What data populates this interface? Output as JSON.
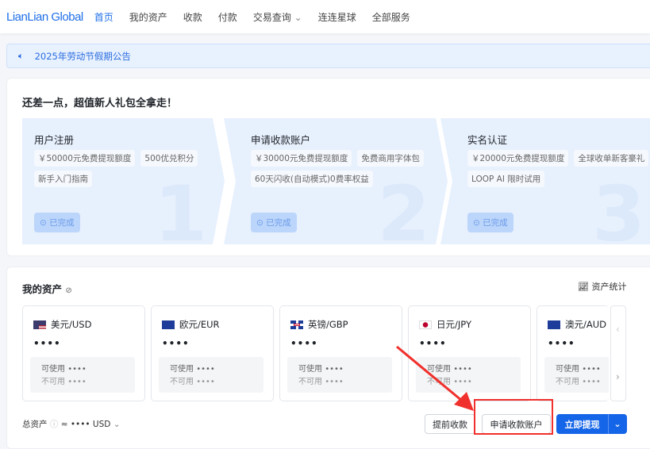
{
  "header": {
    "logo": "LianLian Global",
    "nav": [
      "首页",
      "我的资产",
      "收款",
      "付款",
      "交易查询",
      "连连星球",
      "全部服务"
    ]
  },
  "notice": {
    "text": "2025年劳动节假期公告"
  },
  "promo": {
    "title": "还差一点，超值新人礼包全拿走！",
    "steps": [
      {
        "title": "用户注册",
        "tags": [
          "￥50000元免费提现额度",
          "500优兑积分",
          "新手入门指南"
        ],
        "status": "已完成",
        "num": "1"
      },
      {
        "title": "申请收款账户",
        "tags": [
          "￥30000元免费提现额度",
          "免费商用字体包",
          "60天闪收(自动模式)0费率权益"
        ],
        "status": "已完成",
        "num": "2"
      },
      {
        "title": "实名认证",
        "tags": [
          "￥20000元免费提现额度",
          "全球收单新客豪礼",
          "LOOP AI 限时试用"
        ],
        "status": "已完成",
        "num": "3"
      }
    ]
  },
  "assets": {
    "title": "我的资产",
    "stats": "资产统计",
    "currencies": [
      {
        "name": "美元/USD",
        "balance": "••••",
        "available_label": "可使用",
        "available": "••••",
        "unavailable_label": "不可用",
        "unavailable": "••••"
      },
      {
        "name": "欧元/EUR",
        "balance": "••••",
        "available_label": "可使用",
        "available": "••••",
        "unavailable_label": "不可用",
        "unavailable": "••••"
      },
      {
        "name": "英镑/GBP",
        "balance": "••••",
        "available_label": "可使用",
        "available": "••••",
        "unavailable_label": "不可用",
        "unavailable": "••••"
      },
      {
        "name": "日元/JPY",
        "balance": "••••",
        "available_label": "可使用",
        "available": "••••",
        "unavailable_label": "不可用",
        "unavailable": "••••"
      },
      {
        "name": "澳元/AUD",
        "balance": "••••",
        "available_label": "可使用",
        "available": "••••",
        "unavailable_label": "不可用",
        "unavailable": "••••"
      }
    ],
    "total_label": "总资产",
    "total_value": "≈ •••• USD",
    "buttons": {
      "advance": "提前收款",
      "apply": "申请收款账户",
      "withdraw": "立即提现"
    }
  },
  "colors": {
    "accent": "#1565e8",
    "highlight": "#f0302c"
  }
}
